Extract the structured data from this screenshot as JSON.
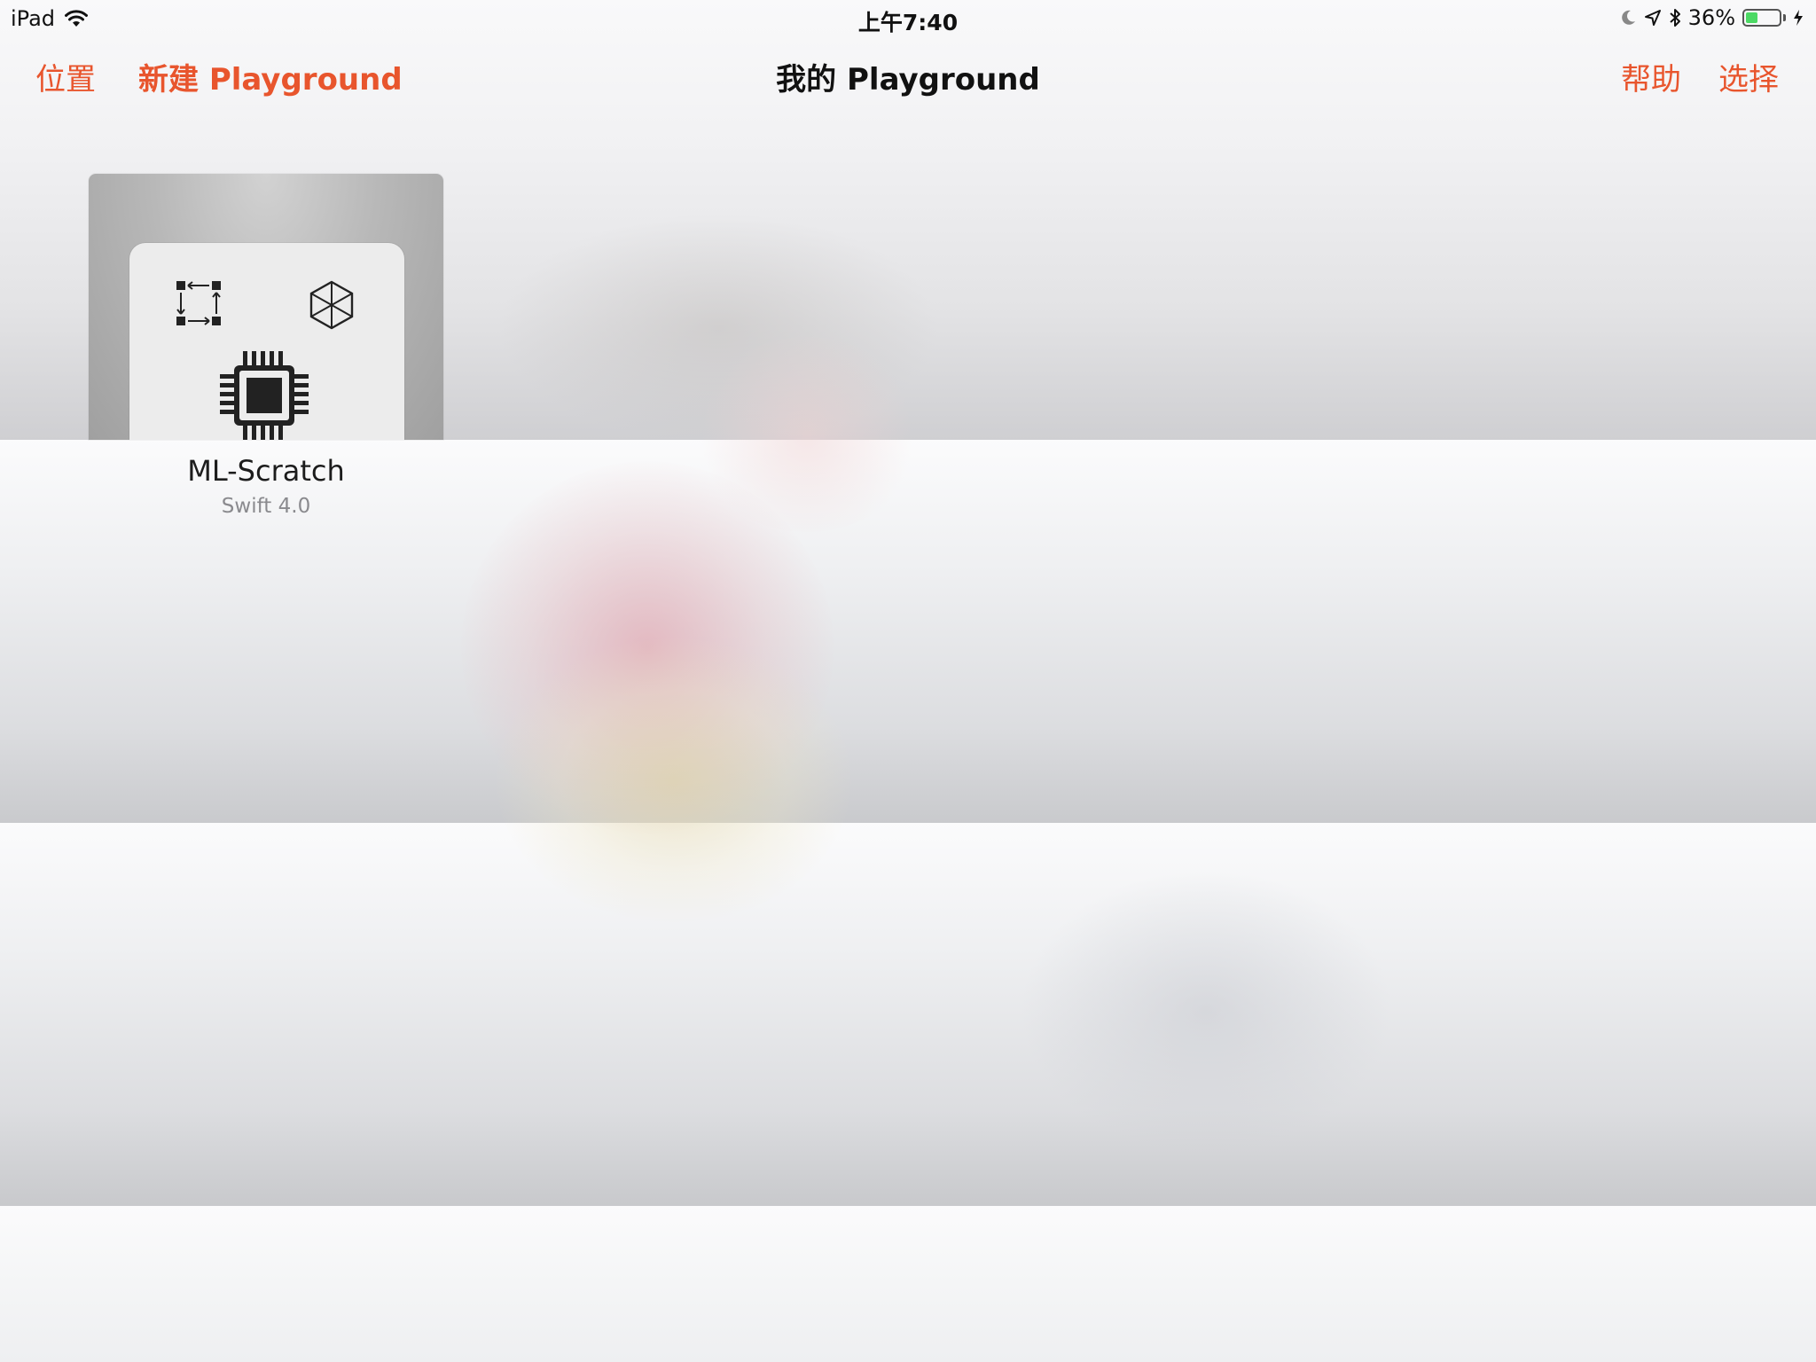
{
  "status_bar": {
    "device": "iPad",
    "time": "上午7:40",
    "battery_text": "36%",
    "battery_level": 0.36,
    "battery_fill_color": "#4cd964",
    "icons": [
      "wifi-icon",
      "moon-icon",
      "location-arrow-icon",
      "bluetooth-icon",
      "battery-icon",
      "charging-bolt-icon"
    ]
  },
  "nav": {
    "location_label": "位置",
    "new_label": "新建 Playground",
    "title": "我的 Playground",
    "help_label": "帮助",
    "select_label": "选择",
    "accent_color": "#e8552d"
  },
  "playgrounds": [
    {
      "name": "ML-Scratch",
      "subtitle": "Swift 4.0",
      "icons": [
        "frame-resize-icon",
        "cube-icon",
        "chip-icon"
      ]
    }
  ]
}
